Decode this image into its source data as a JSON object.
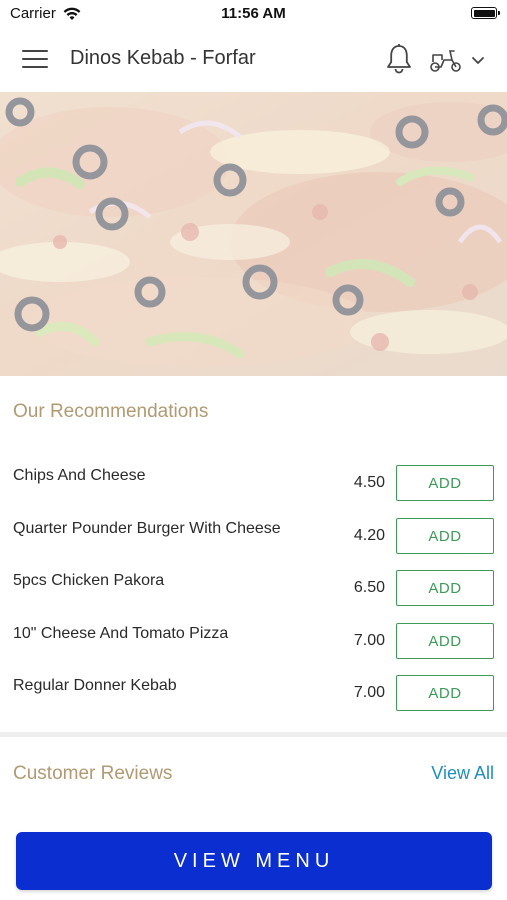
{
  "status_bar": {
    "carrier": "Carrier",
    "time": "11:56 AM"
  },
  "header": {
    "title": "Dinos Kebab - Forfar",
    "icons": [
      "menu-icon",
      "bell-icon",
      "scooter-icon",
      "chevron-down-icon"
    ]
  },
  "recommendations": {
    "title": "Our Recommendations",
    "add_label": "ADD",
    "items": [
      {
        "name": "Chips And Cheese",
        "price": "4.50"
      },
      {
        "name": "Quarter Pounder Burger With Cheese",
        "price": "4.20"
      },
      {
        "name": "5pcs Chicken Pakora",
        "price": "6.50"
      },
      {
        "name": "10\" Cheese And Tomato Pizza",
        "price": "7.00"
      },
      {
        "name": "Regular Donner Kebab",
        "price": "7.00"
      }
    ]
  },
  "reviews": {
    "title": "Customer Reviews",
    "view_all": "View All"
  },
  "cta": {
    "label": "VIEW MENU"
  },
  "colors": {
    "accent_green": "#3f9a5a",
    "section_title": "#b19a73",
    "link_blue": "#1f8fbf",
    "cta_blue": "#0a2ecf"
  }
}
